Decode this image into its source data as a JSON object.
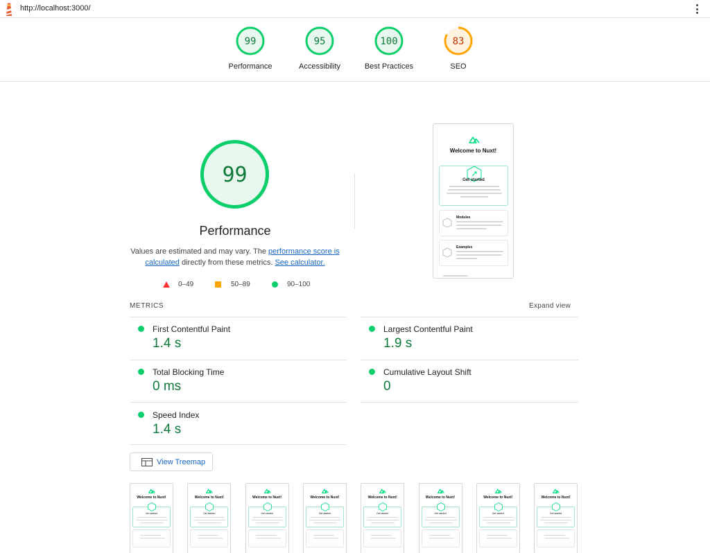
{
  "browser": {
    "url": "http://localhost:3000/"
  },
  "categories": [
    {
      "label": "Performance",
      "score": "99",
      "color": "#0cce6b",
      "text_color": "#0d7a3a",
      "bg": "#e8f8ef"
    },
    {
      "label": "Accessibility",
      "score": "95",
      "color": "#0cce6b",
      "text_color": "#0d7a3a",
      "bg": "#e8f8ef"
    },
    {
      "label": "Best Practices",
      "score": "100",
      "color": "#0cce6b",
      "text_color": "#0d7a3a",
      "bg": "#e8f8ef"
    },
    {
      "label": "SEO",
      "score": "83",
      "color": "#ffa400",
      "text_color": "#c33300",
      "bg": "#fff3e0"
    }
  ],
  "performance": {
    "score": "99",
    "title": "Performance",
    "desc_prefix": "Values are estimated and may vary. The ",
    "desc_link1": "performance score is calculated",
    "desc_middle": " directly from these metrics. ",
    "desc_link2": "See calculator.",
    "legend": {
      "fail": "0–49",
      "average": "50–89",
      "pass": "90–100"
    }
  },
  "preview": {
    "title": "Welcome to Nuxt!",
    "card1_title": "Get started",
    "card2_title": "Modules",
    "card3_title": "Examples"
  },
  "metrics": {
    "header": "METRICS",
    "expand_label": "Expand view",
    "items": [
      {
        "name": "First Contentful Paint",
        "value": "1.4 s"
      },
      {
        "name": "Largest Contentful Paint",
        "value": "1.9 s"
      },
      {
        "name": "Total Blocking Time",
        "value": "0 ms"
      },
      {
        "name": "Cumulative Layout Shift",
        "value": "0"
      },
      {
        "name": "Speed Index",
        "value": "1.4 s"
      }
    ]
  },
  "treemap": {
    "label": "View Treemap"
  },
  "filmstrip": {
    "frame_title": "Welcome to Nuxt!",
    "frame_card": "Get started",
    "frame_count": 8
  }
}
